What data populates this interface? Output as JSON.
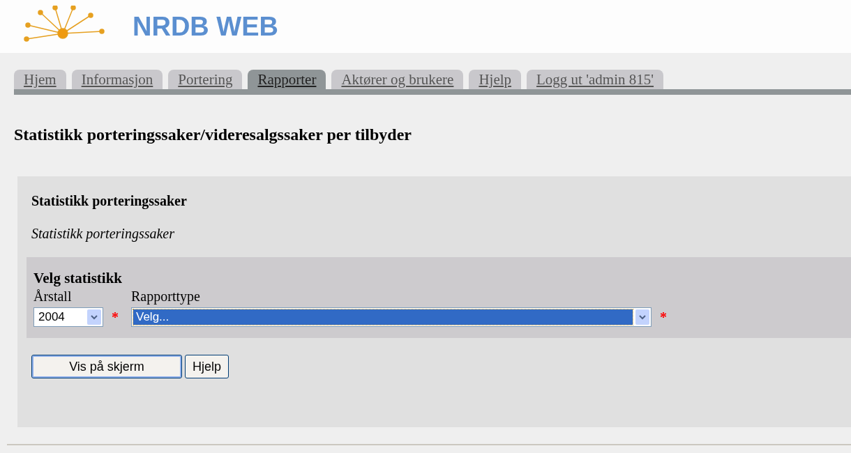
{
  "header": {
    "title": "NRDB WEB"
  },
  "tabs": [
    {
      "label": "Hjem",
      "selected": false
    },
    {
      "label": "Informasjon",
      "selected": false
    },
    {
      "label": "Portering",
      "selected": false
    },
    {
      "label": "Rapporter",
      "selected": true
    },
    {
      "label": "Aktører og brukere",
      "selected": false
    },
    {
      "label": "Hjelp",
      "selected": false
    },
    {
      "label": "Logg ut 'admin  815'",
      "selected": false
    }
  ],
  "page_title": "Statistikk porteringssaker/videresalgssaker per tilbyder",
  "panel": {
    "title": "Statistikk porteringssaker",
    "description": "Statistikk porteringssaker",
    "form": {
      "title": "Velg statistikk",
      "fields": [
        {
          "label": "Årstall",
          "value": "2004",
          "focused": false,
          "required_mark": "*"
        },
        {
          "label": "Rapporttype",
          "value": "Velg...",
          "focused": true,
          "required_mark": "*"
        }
      ]
    },
    "buttons": [
      {
        "label": "Vis på skjerm",
        "default": true
      },
      {
        "label": "Hjelp",
        "default": false
      }
    ]
  }
}
